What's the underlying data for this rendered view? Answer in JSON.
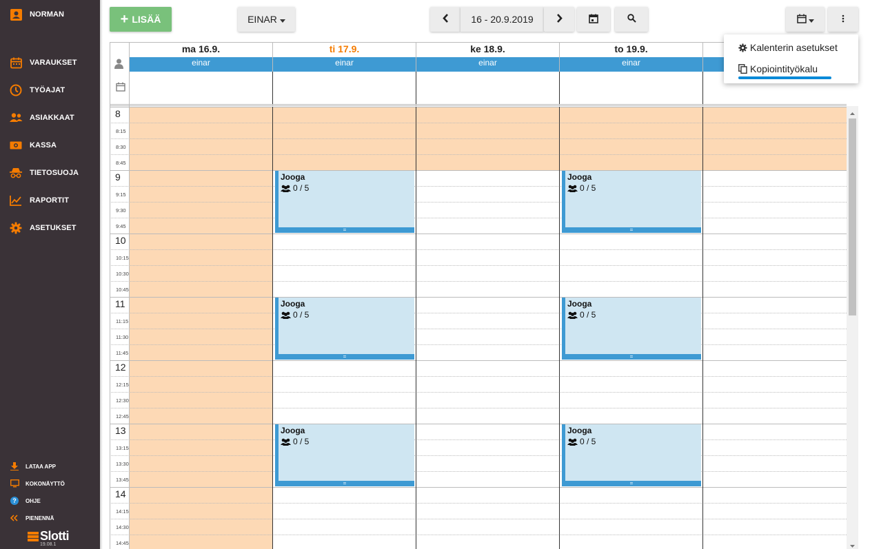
{
  "sidebar": {
    "user": "NORMAN",
    "items": [
      {
        "label": "VARAUKSET",
        "icon": "calendar-icon"
      },
      {
        "label": "TYÖAJAT",
        "icon": "clock-icon"
      },
      {
        "label": "ASIAKKAAT",
        "icon": "people-icon"
      },
      {
        "label": "KASSA",
        "icon": "money-icon"
      },
      {
        "label": "TIETOSUOJA",
        "icon": "spy-icon"
      },
      {
        "label": "RAPORTIT",
        "icon": "chart-icon"
      },
      {
        "label": "ASETUKSET",
        "icon": "gear-icon"
      }
    ],
    "bottom": [
      {
        "label": "LATAA APP",
        "icon": "download-icon"
      },
      {
        "label": "KOKONÄYTTÖ",
        "icon": "monitor-icon"
      },
      {
        "label": "OHJE",
        "icon": "help-icon"
      },
      {
        "label": "PIENENNÄ",
        "icon": "collapse-icon"
      }
    ],
    "logo": "Slotti",
    "version": "19.08.1"
  },
  "toolbar": {
    "add_label": "LISÄÄ",
    "staff_label": "EINAR",
    "date_range": "16 - 20.9.2019"
  },
  "menu": {
    "items": [
      {
        "label": "Kalenterin asetukset",
        "icon": "gear-icon"
      },
      {
        "label": "Kopiointityökalu",
        "icon": "copy-icon"
      }
    ]
  },
  "days": [
    {
      "label": "ma 16.9.",
      "staff": "einar",
      "today": false
    },
    {
      "label": "ti 17.9.",
      "staff": "einar",
      "today": true
    },
    {
      "label": "ke 18.9.",
      "staff": "einar",
      "today": false
    },
    {
      "label": "to 19.9.",
      "staff": "einar",
      "today": false
    },
    {
      "label": "",
      "staff": "",
      "today": false
    }
  ],
  "hours": [
    {
      "hour": "8",
      "quarters": [
        "8:15",
        "8:30",
        "8:45"
      ]
    },
    {
      "hour": "9",
      "quarters": [
        "9:15",
        "9:30",
        "9:45"
      ]
    },
    {
      "hour": "10",
      "quarters": [
        "10:15",
        "10:30",
        "10:45"
      ]
    },
    {
      "hour": "11",
      "quarters": [
        "11:15",
        "11:30",
        "11:45"
      ]
    },
    {
      "hour": "12",
      "quarters": [
        "12:15",
        "12:30",
        "12:45"
      ]
    },
    {
      "hour": "13",
      "quarters": [
        "13:15",
        "13:30",
        "13:45"
      ]
    },
    {
      "hour": "14",
      "quarters": [
        "14:15",
        "14:30",
        "14:45"
      ]
    }
  ],
  "events": [
    {
      "title": "Jooga",
      "count": "0 / 5",
      "day": 1,
      "start": "9:00",
      "end": "10:00"
    },
    {
      "title": "Jooga",
      "count": "0 / 5",
      "day": 3,
      "start": "9:00",
      "end": "10:00"
    },
    {
      "title": "Jooga",
      "count": "0 / 5",
      "day": 1,
      "start": "11:00",
      "end": "12:00"
    },
    {
      "title": "Jooga",
      "count": "0 / 5",
      "day": 3,
      "start": "11:00",
      "end": "12:00"
    },
    {
      "title": "Jooga",
      "count": "0 / 5",
      "day": 1,
      "start": "13:00",
      "end": "14:00"
    },
    {
      "title": "Jooga",
      "count": "0 / 5",
      "day": 3,
      "start": "13:00",
      "end": "14:00"
    }
  ],
  "event_handle": "=",
  "colors": {
    "sidebar": "#3a3237",
    "accent": "#f57c00",
    "staff_bar": "#3e9ad3",
    "event_fill": "#cfe6f2",
    "closed": "#fdd9b5",
    "add_button": "#79c17b",
    "today": "#f57c00"
  }
}
